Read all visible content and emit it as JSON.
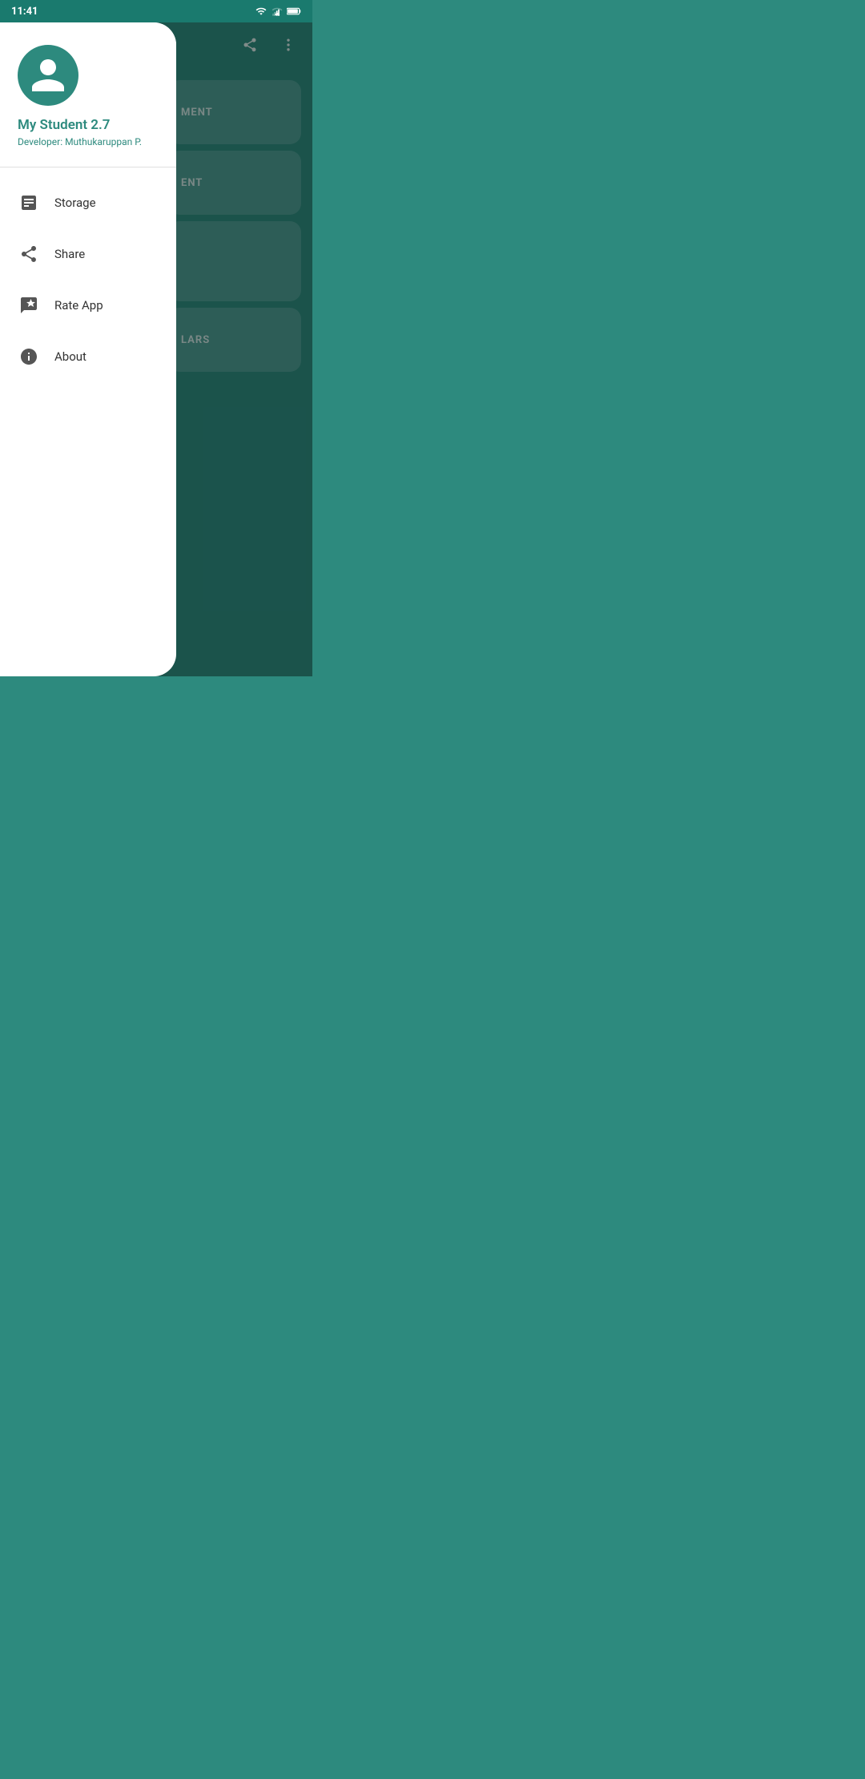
{
  "statusBar": {
    "time": "11:41"
  },
  "background": {
    "cards": [
      {
        "text": "MENT"
      },
      {
        "text": "ENT"
      },
      {
        "text": ""
      },
      {
        "text": "LARS"
      }
    ]
  },
  "drawer": {
    "appTitle": "My Student 2.7",
    "developer": "Developer: Muthukaruppan P.",
    "menuItems": [
      {
        "id": "storage",
        "label": "Storage",
        "icon": "storage"
      },
      {
        "id": "share",
        "label": "Share",
        "icon": "share"
      },
      {
        "id": "rate-app",
        "label": "Rate App",
        "icon": "rate"
      },
      {
        "id": "about",
        "label": "About",
        "icon": "info"
      }
    ]
  },
  "toolbar": {
    "shareIcon": "share",
    "moreIcon": "more-vert"
  },
  "nav": {
    "back": "◀",
    "home": "⬤",
    "recent": "■"
  }
}
